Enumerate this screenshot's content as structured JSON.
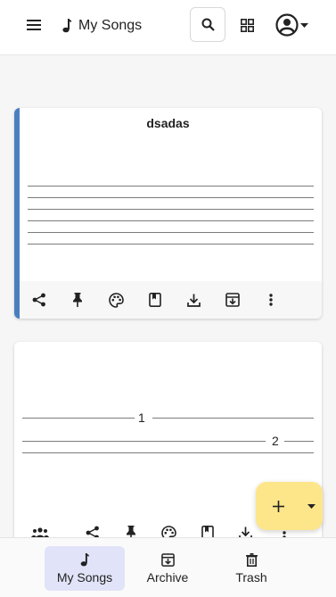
{
  "appbar": {
    "menu_icon": "hamburger-menu-icon",
    "title_icon": "music-note-icon",
    "title": "My Songs",
    "search_icon": "search-icon",
    "grid_icon": "grid-view-icon",
    "account_icon": "account-circle-icon"
  },
  "cards": [
    {
      "title": "dsadas",
      "accent_color": "#4a7fbf",
      "toolbar": [
        "share-icon",
        "pin-icon",
        "palette-icon",
        "bookmark-icon",
        "download-icon",
        "archive-icon",
        "more-vert-icon"
      ]
    },
    {
      "title": "",
      "labels": [
        "1",
        "2"
      ],
      "toolbar": [
        "collaborators-icon",
        "share-icon",
        "pin-icon",
        "palette-icon",
        "bookmark-icon",
        "download-icon",
        "more-vert-icon"
      ]
    }
  ],
  "fab": {
    "plus_icon": "plus-icon",
    "caret_icon": "caret-down-icon",
    "color": "#fde68a"
  },
  "bottom_nav": {
    "items": [
      {
        "label": "My Songs",
        "icon": "music-note-icon",
        "active": true
      },
      {
        "label": "Archive",
        "icon": "archive-icon",
        "active": false
      },
      {
        "label": "Trash",
        "icon": "trash-icon",
        "active": false
      }
    ]
  }
}
